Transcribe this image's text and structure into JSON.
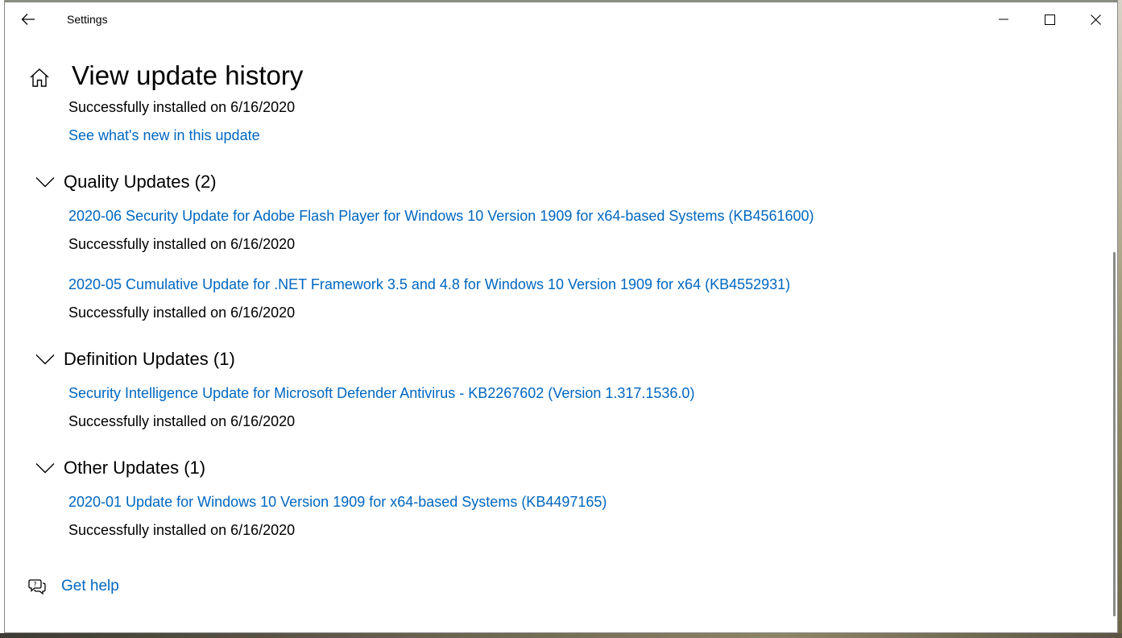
{
  "window": {
    "title": "Settings"
  },
  "page": {
    "title": "View update history"
  },
  "top_entry": {
    "status": "Successfully installed on 6/16/2020",
    "link": "See what's new in this update"
  },
  "sections": [
    {
      "heading": "Quality Updates (2)",
      "items": [
        {
          "name": "2020-06 Security Update for Adobe Flash Player for Windows 10 Version 1909 for x64-based Systems (KB4561600)",
          "status": "Successfully installed on 6/16/2020"
        },
        {
          "name": "2020-05 Cumulative Update for .NET Framework 3.5 and 4.8 for Windows 10 Version 1909 for x64 (KB4552931)",
          "status": "Successfully installed on 6/16/2020"
        }
      ]
    },
    {
      "heading": "Definition Updates (1)",
      "items": [
        {
          "name": "Security Intelligence Update for Microsoft Defender Antivirus - KB2267602 (Version 1.317.1536.0)",
          "status": "Successfully installed on 6/16/2020"
        }
      ]
    },
    {
      "heading": "Other Updates (1)",
      "items": [
        {
          "name": "2020-01 Update for Windows 10 Version 1909 for x64-based Systems (KB4497165)",
          "status": "Successfully installed on 6/16/2020"
        }
      ]
    }
  ],
  "help": {
    "label": "Get help"
  },
  "icons": {
    "back": "back-arrow-icon",
    "home": "home-icon",
    "minimize": "minimize-icon",
    "maximize": "maximize-icon",
    "close": "close-icon",
    "chevron": "chevron-down-icon",
    "help": "help-chat-icon"
  },
  "colors": {
    "link": "#0067c0",
    "text": "#000000",
    "background": "#ffffff"
  }
}
